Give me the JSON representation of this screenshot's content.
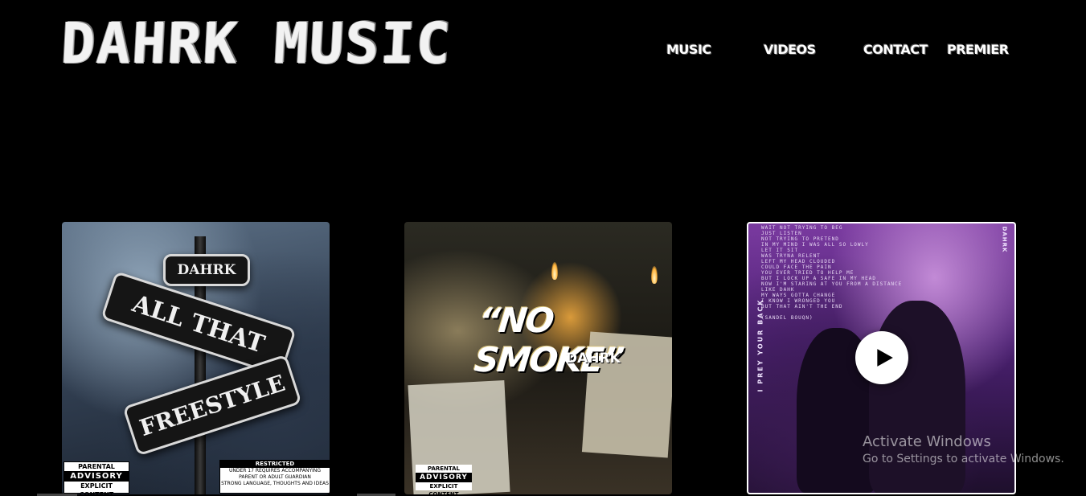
{
  "site": {
    "logo": "DAHRK MUSIC"
  },
  "nav": {
    "items": [
      {
        "label": "MUSIC"
      },
      {
        "label": "VIDEOS"
      },
      {
        "label": "CONTACT"
      },
      {
        "label": "PREMIER"
      }
    ]
  },
  "cards": [
    {
      "artist_sign": "DAHRK",
      "title_line1": "ALL THAT",
      "title_line2": "FREESTYLE",
      "advisory": {
        "top": "PARENTAL",
        "mid": "ADVISORY",
        "bottom": "EXPLICIT CONTENT"
      },
      "rating": {
        "head": "RESTRICTED",
        "line1": "UNDER 17 REQUIRES ACCOMPANYING",
        "line2": "PARENT OR ADULT GUARDIAN",
        "line3": "STRONG LANGUAGE, THOUGHTS AND IDEAS"
      }
    },
    {
      "title": "“NO SMOKE”",
      "artist": "DAHRK",
      "advisory": {
        "top": "PARENTAL",
        "mid": "ADVISORY",
        "bottom": "EXPLICIT CONTENT"
      }
    },
    {
      "lyrics": "WAIT NOT TRYING TO BEG\nJUST LISTEN\nNOT TRYING TO PRETEND\nIN MY MIND I WAS ALL SO LOWLY\nLET IT SIT\nWAS TRYNA RELENT\nLEFT MY HEAD CLOUDED\nCOULD FACE THE PAIN\nYOU EVER TRIED TO HELP ME\nBUT I LOCK UP A SAFE IN MY HEAD\nNOW I'M STARING AT YOU FROM A DISTANCE\nLIKE DAHK\nMY WAYS GOTTA CHANGE\nI KNOW I WRONGED YOU\nBUT THAT AIN'T THE END\n\n(SANDEL BOUQN)",
      "vertical_left": "I PREY YOUR BACK",
      "vertical_right": "DAHRK",
      "has_video": true
    }
  ],
  "watermark": {
    "title": "Activate Windows",
    "subtitle": "Go to Settings to activate Windows."
  }
}
